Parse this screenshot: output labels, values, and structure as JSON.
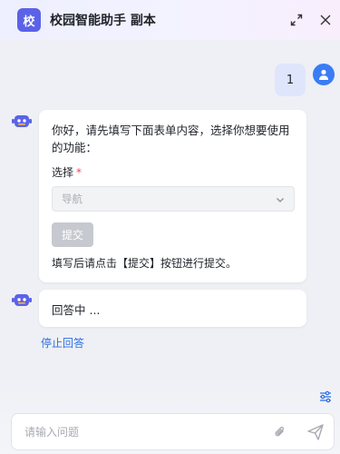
{
  "header": {
    "logo_text": "校",
    "title": "校园智能助手 副本",
    "expand_icon": "expand-icon",
    "close_icon": "close-icon"
  },
  "chat": {
    "user_message": "1",
    "bot_message": {
      "intro": "你好，请先填写下面表单内容，选择你想要使用的功能：",
      "field_label": "选择",
      "required_mark": "*",
      "select_value": "导航",
      "submit_label": "提交",
      "hint": "填写后请点击【提交】按钮进行提交。"
    },
    "answering_text": "回答中 ...",
    "stop_label": "停止回答"
  },
  "composer": {
    "placeholder": "请输入问题",
    "settings_icon": "settings-sliders-icon",
    "attach_icon": "paperclip-icon",
    "send_icon": "send-icon"
  },
  "colors": {
    "accent": "#5b62e8",
    "user_bubble": "#dfe6fc",
    "link": "#2f6fe3",
    "disabled_button": "#c6c9cf"
  }
}
